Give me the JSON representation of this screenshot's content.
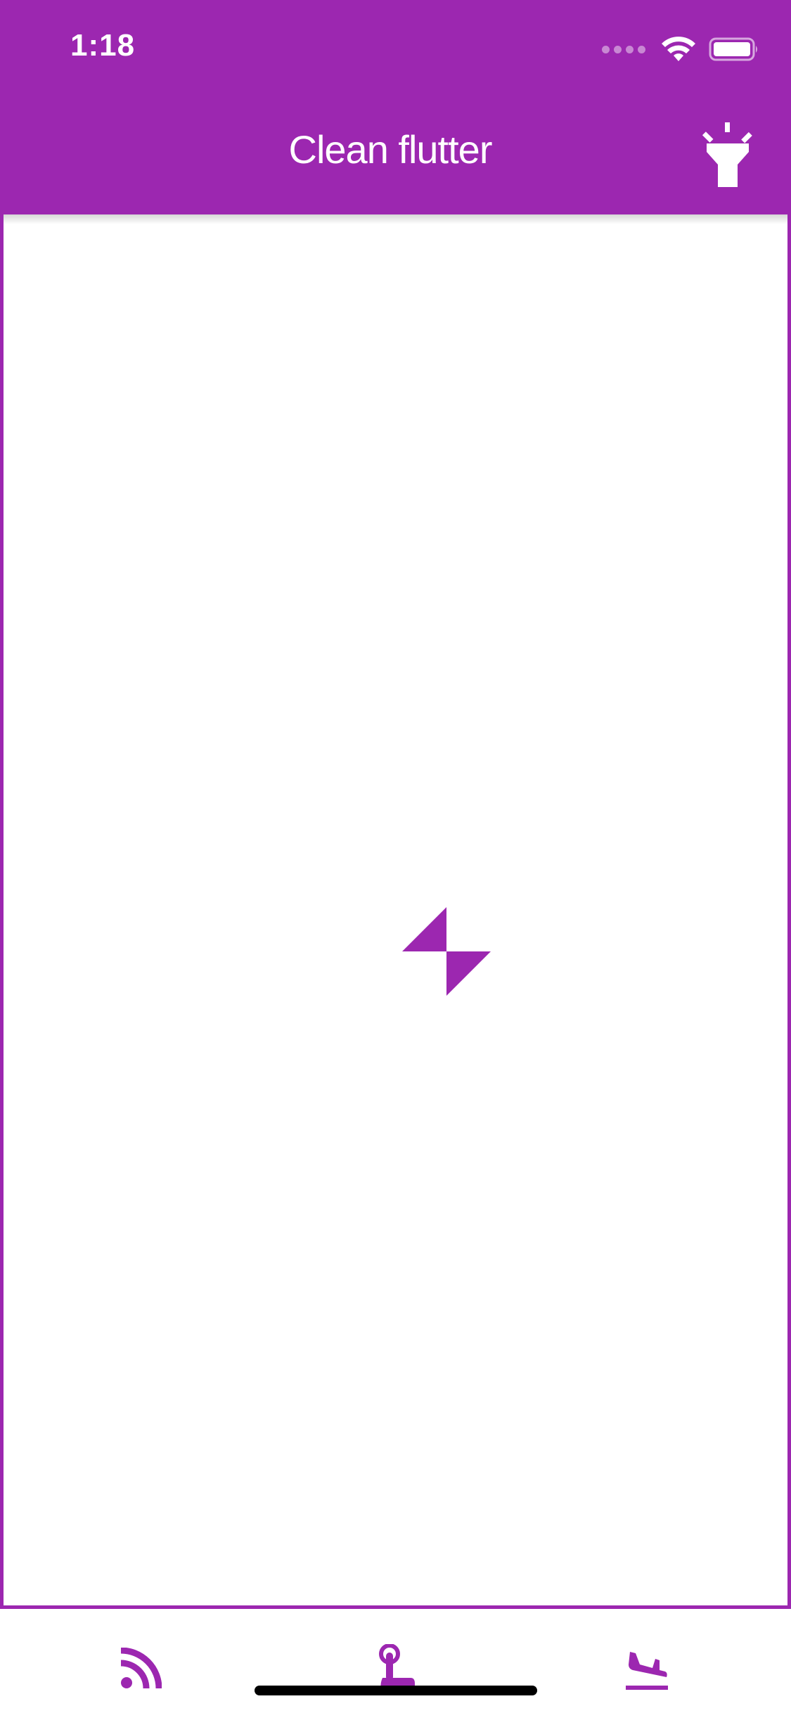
{
  "status_bar": {
    "time": "1:18"
  },
  "app_bar": {
    "title": "Clean flutter",
    "action_icon": "flashlight-icon"
  },
  "content": {
    "state": "loading",
    "indicator_icon": "hourglass-spinner-icon"
  },
  "bottom_nav": {
    "items": [
      {
        "icon": "rss-feed-icon"
      },
      {
        "icon": "touch-app-icon"
      },
      {
        "icon": "flight-land-icon"
      }
    ]
  },
  "colors": {
    "primary": "#9c27b0",
    "on_primary": "#ffffff",
    "background": "#ffffff"
  }
}
